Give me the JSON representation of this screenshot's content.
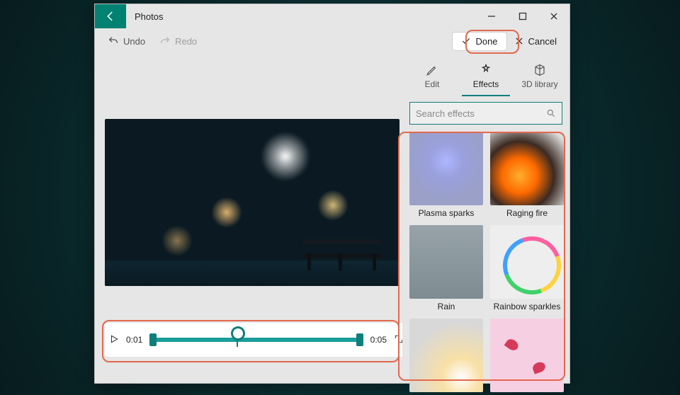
{
  "app_title": "Photos",
  "toolbar": {
    "undo_label": "Undo",
    "redo_label": "Redo",
    "done_label": "Done",
    "cancel_label": "Cancel"
  },
  "side": {
    "tabs": {
      "edit": "Edit",
      "effects": "Effects",
      "library": "3D library"
    },
    "search_placeholder": "Search effects",
    "effects": [
      {
        "label": "Plasma sparks"
      },
      {
        "label": "Raging fire"
      },
      {
        "label": "Rain"
      },
      {
        "label": "Rainbow sparkles"
      },
      {
        "label": ""
      },
      {
        "label": ""
      }
    ]
  },
  "player": {
    "current_time": "0:01",
    "total_time": "0:05"
  },
  "colors": {
    "accent": "#0f7f7b",
    "highlight": "#e2694e"
  }
}
